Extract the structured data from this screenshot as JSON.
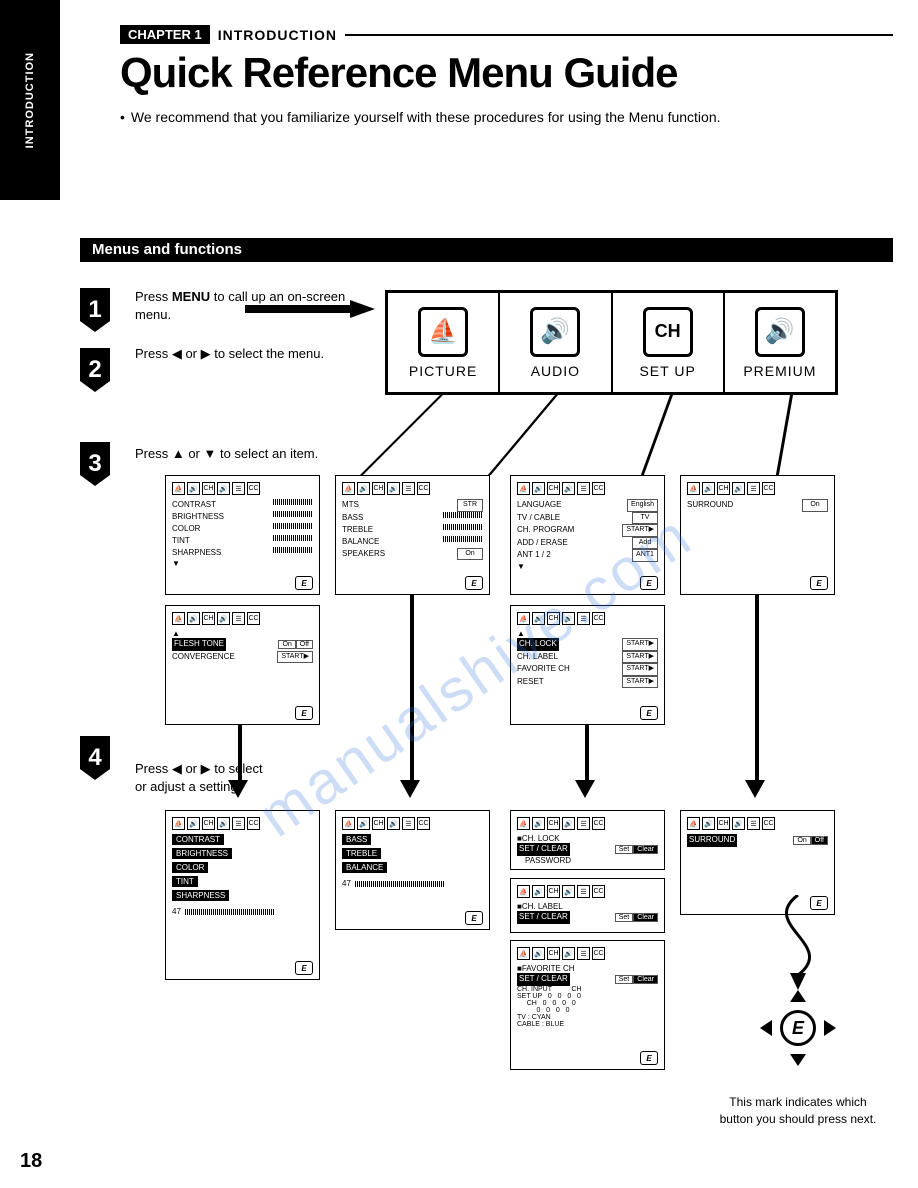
{
  "side_tab": "INTRODUCTION",
  "chapter": {
    "badge": "CHAPTER 1",
    "label": "INTRODUCTION"
  },
  "title": "Quick Reference Menu Guide",
  "intro_bullet": "•",
  "intro": "We recommend that you familiarize yourself with these procedures for using the Menu function.",
  "section": "Menus and functions",
  "steps": {
    "s1": {
      "num": "1",
      "text_a": "Press ",
      "text_b": "MENU",
      "text_c": " to call up an on-screen menu."
    },
    "s2": {
      "num": "2",
      "text": "Press ◀ or ▶ to select the menu."
    },
    "s3": {
      "num": "3",
      "text": "Press ▲ or ▼ to select an item."
    },
    "s4": {
      "num": "4",
      "text": "Press ◀ or ▶ to select or adjust a setting."
    }
  },
  "menu_tabs": [
    {
      "label": "PICTURE",
      "icon": "⛵"
    },
    {
      "label": "AUDIO",
      "icon": "🔊"
    },
    {
      "label": "SET UP",
      "icon": "CH"
    },
    {
      "label": "PREMIUM",
      "icon": "🔊"
    }
  ],
  "panels": {
    "picture1": {
      "items": [
        {
          "k": "CONTRAST",
          "type": "slider"
        },
        {
          "k": "BRIGHTNESS",
          "type": "slider"
        },
        {
          "k": "COLOR",
          "type": "slider"
        },
        {
          "k": "TINT",
          "type": "slider"
        },
        {
          "k": "SHARPNESS",
          "type": "slider"
        }
      ],
      "more": "▼"
    },
    "picture2": {
      "more_up": "▲",
      "items": [
        {
          "k": "FLESH TONE",
          "v": "On",
          "v2": "Off"
        },
        {
          "k": "CONVERGENCE",
          "v": "START▶"
        }
      ]
    },
    "audio1": {
      "items": [
        {
          "k": "MTS",
          "v": "STR"
        },
        {
          "k": "BASS",
          "type": "slider"
        },
        {
          "k": "TREBLE",
          "type": "slider"
        },
        {
          "k": "BALANCE",
          "type": "slider"
        },
        {
          "k": "SPEAKERS",
          "v": "On"
        }
      ]
    },
    "setup1": {
      "items": [
        {
          "k": "LANGUAGE",
          "v": "English"
        },
        {
          "k": "TV / CABLE",
          "v": "TV"
        },
        {
          "k": "CH. PROGRAM",
          "v": "START▶"
        },
        {
          "k": "ADD / ERASE",
          "v": "Add"
        },
        {
          "k": "ANT 1 / 2",
          "v": "ANT1"
        }
      ],
      "more": "▼"
    },
    "setup2": {
      "more_up": "▲",
      "items": [
        {
          "k": "CH. LOCK",
          "v": "START▶"
        },
        {
          "k": "CH. LABEL",
          "v": "START▶"
        },
        {
          "k": "FAVORITE CH",
          "v": "START▶"
        },
        {
          "k": "RESET",
          "v": "START▶"
        }
      ]
    },
    "premium1": {
      "items": [
        {
          "k": "SURROUND",
          "v": "On"
        }
      ]
    },
    "picture_adj": {
      "items": [
        "CONTRAST",
        "BRIGHTNESS",
        "COLOR",
        "TINT",
        "SHARPNESS"
      ],
      "value": "47"
    },
    "audio_adj": {
      "items": [
        "BASS",
        "TREBLE",
        "BALANCE"
      ],
      "value": "47"
    },
    "setup_adj1": {
      "title": "■CH. LOCK",
      "row": {
        "k": "SET / CLEAR",
        "v1": "Set",
        "v2": "Clear"
      },
      "sub": "PASSWORD"
    },
    "setup_adj2": {
      "title": "■CH. LABEL",
      "row": {
        "k": "SET / CLEAR",
        "v1": "Set",
        "v2": "Clear"
      }
    },
    "setup_adj3": {
      "title": "■FAVORITE CH",
      "row": {
        "k": "SET / CLEAR",
        "v1": "Set",
        "v2": "Clear"
      },
      "lines": [
        "CH. INPUT          CH",
        "SET UP   0   0   0   0",
        "     CH   0   0   0   0",
        "          0   0   0   0",
        "TV : CYAN",
        "CABLE : BLUE"
      ]
    },
    "premium_adj": {
      "items": [
        {
          "k": "SURROUND",
          "v1": "On",
          "v2": "Off"
        }
      ]
    }
  },
  "e_icon": "E",
  "footnote": "This mark indicates which button you should press next.",
  "page_number": "18",
  "icon_bar": [
    "⛵",
    "🔊",
    "CH",
    "🔊",
    "☰",
    "CC"
  ]
}
